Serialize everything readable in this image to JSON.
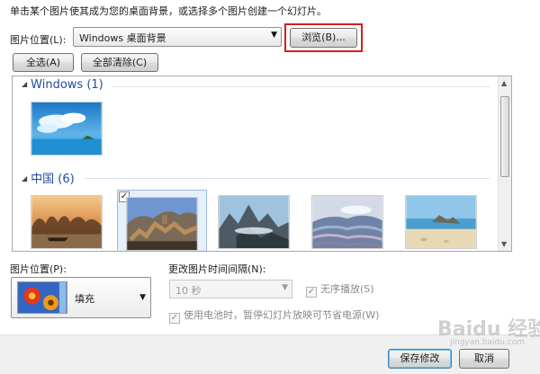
{
  "instruction": "单击某个图片使其成为您的桌面背景，或选择多个图片创建一个幻灯片。",
  "picture_location": {
    "label": "图片位置(L):",
    "value": "Windows 桌面背景",
    "browse_label": "浏览(B)..."
  },
  "buttons": {
    "select_all": "全选(A)",
    "clear_all": "全部清除(C)"
  },
  "groups": [
    {
      "title": "Windows (1)",
      "thumbs": [
        "sky-clouds-island"
      ]
    },
    {
      "title": "中国 (6)",
      "thumbs": [
        "karst-river-sunset",
        "great-wall",
        "misty-mountains",
        "rice-terraces",
        "sandy-beach-rocks"
      ]
    }
  ],
  "selected_thumb": "great-wall",
  "checked_mark": "✓",
  "picture_position": {
    "label": "图片位置(P):",
    "value": "填充"
  },
  "interval": {
    "label": "更改图片时间间隔(N):",
    "value": "10 秒"
  },
  "shuffle": {
    "label": "无序播放(S)",
    "checked": true
  },
  "battery": {
    "label": "使用电池时，暂停幻灯片放映可节省电源(W)",
    "checked": true
  },
  "footer": {
    "save_label": "保存修改",
    "cancel_label": "取消"
  },
  "watermark": {
    "text": "Baidu 经验",
    "sub": "jingyan.baidu.com"
  },
  "colors": {
    "highlight": "#d91c1c",
    "group_title": "#1e4d9a",
    "selection_fill": "#e6f0fb"
  }
}
